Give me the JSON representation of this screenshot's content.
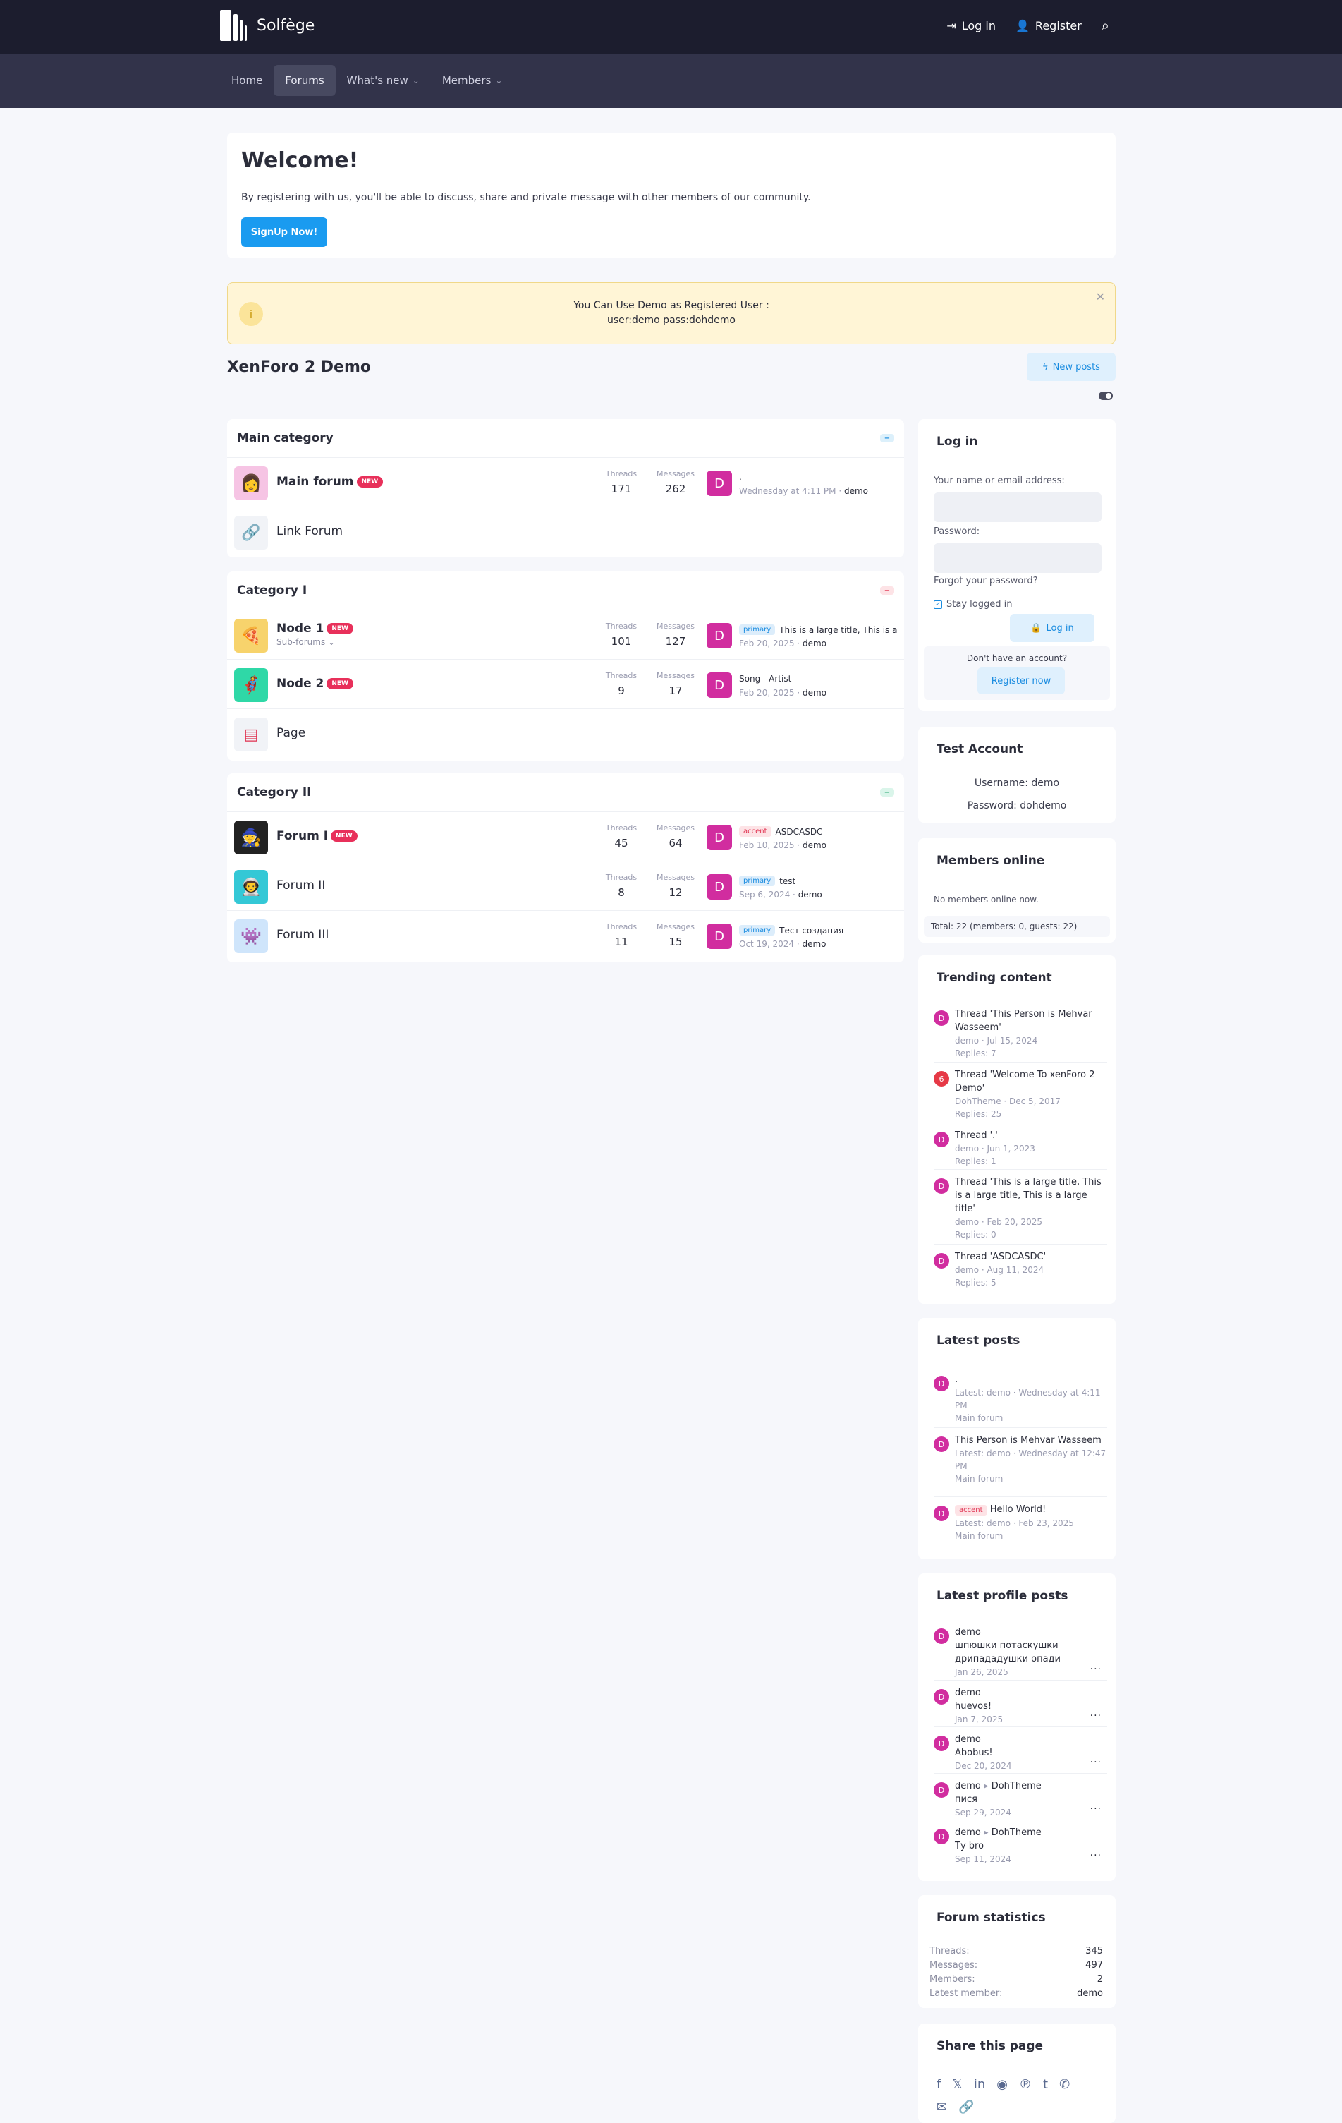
{
  "brand": {
    "name": "Solfège"
  },
  "topnav": {
    "login": "Log in",
    "register": "Register"
  },
  "tabs": {
    "home": "Home",
    "forums": "Forums",
    "whatsnew": "What's new",
    "members": "Members"
  },
  "welcome": {
    "title": "Welcome!",
    "text": "By registering with us, you'll be able to discuss, share and private message with other members of our community.",
    "button": "SignUp Now!"
  },
  "notice": {
    "line1": "You Can Use Demo as Registered User :",
    "line2": "user:demo pass:dohdemo"
  },
  "page": {
    "title": "XenForo 2 Demo",
    "new_posts": "New posts"
  },
  "labels": {
    "threads": "Threads",
    "messages": "Messages",
    "new": "NEW",
    "primary": "primary",
    "accent": "accent"
  },
  "categories": [
    {
      "title": "Main category",
      "nodes": [
        {
          "name": "Main forum",
          "threads": "171",
          "messages": "262",
          "lp_title": ".",
          "lp_date": "Wednesday at 4:11 PM",
          "lp_user": "demo"
        },
        {
          "name": "Link Forum"
        }
      ]
    },
    {
      "title": "Category I",
      "nodes": [
        {
          "name": "Node 1",
          "sub": "Sub-forums",
          "threads": "101",
          "messages": "127",
          "lp_title": "This is a large title, This is a large title",
          "lp_date": "Feb 20, 2025",
          "lp_user": "demo"
        },
        {
          "name": "Node 2",
          "threads": "9",
          "messages": "17",
          "lp_title": "Song - Artist",
          "lp_date": "Feb 20, 2025",
          "lp_user": "demo"
        },
        {
          "name": "Page"
        }
      ]
    },
    {
      "title": "Category II",
      "nodes": [
        {
          "name": "Forum I",
          "threads": "45",
          "messages": "64",
          "lp_title": "ASDCASDC",
          "lp_date": "Feb 10, 2025",
          "lp_user": "demo"
        },
        {
          "name": "Forum II",
          "threads": "8",
          "messages": "12",
          "lp_title": "test",
          "lp_date": "Sep 6, 2024",
          "lp_user": "demo"
        },
        {
          "name": "Forum III",
          "threads": "11",
          "messages": "15",
          "lp_title": "Тест создания",
          "lp_date": "Oct 19, 2024",
          "lp_user": "demo"
        }
      ]
    }
  ],
  "login": {
    "title": "Log in",
    "user_label": "Your name or email address:",
    "pass_label": "Password:",
    "forgot": "Forgot your password?",
    "stay": "Stay logged in",
    "button": "Log in",
    "no_account": "Don't have an account?",
    "register": "Register now"
  },
  "test_account": {
    "title": "Test Account",
    "username": "Username: demo",
    "password": "Password: dohdemo"
  },
  "members_online": {
    "title": "Members online",
    "none": "No members online now.",
    "total": "Total: 22 (members: 0, guests: 22)"
  },
  "trending": {
    "title": "Trending content",
    "items": [
      {
        "av": "D",
        "title": "Thread 'This Person is Mehvar Wasseem'",
        "meta": "demo · Jul 15, 2024",
        "replies": "Replies: 7"
      },
      {
        "av": "6",
        "title": "Thread 'Welcome To xenForo 2 Demo'",
        "meta": "DohTheme · Dec 5, 2017",
        "replies": "Replies: 25"
      },
      {
        "av": "D",
        "title": "Thread '.'",
        "meta": "demo · Jun 1, 2023",
        "replies": "Replies: 1"
      },
      {
        "av": "D",
        "title": "Thread 'This is a large title, This is a large title, This is a large title'",
        "meta": "demo · Feb 20, 2025",
        "replies": "Replies: 0"
      },
      {
        "av": "D",
        "title": "Thread 'ASDCASDC'",
        "meta": "demo · Aug 11, 2024",
        "replies": "Replies: 5"
      }
    ]
  },
  "latest_posts": {
    "title": "Latest posts",
    "items": [
      {
        "title": ".",
        "meta": "Latest: demo · Wednesday at 4:11 PM",
        "forum": "Main forum"
      },
      {
        "title": "This Person is Mehvar Wasseem",
        "meta": "Latest: demo · Wednesday at 12:47 PM",
        "forum": "Main forum"
      },
      {
        "title": "Hello World!",
        "meta": "Latest: demo · Feb 23, 2025",
        "forum": "Main forum"
      }
    ]
  },
  "profile_posts": {
    "title": "Latest profile posts",
    "items": [
      {
        "user": "demo",
        "text": "шпюшки потаскушки дрипададушки опади",
        "date": "Jan 26, 2025"
      },
      {
        "user": "demo",
        "text": "huevos!",
        "date": "Jan 7, 2025"
      },
      {
        "user": "demo",
        "text": "Abobus!",
        "date": "Dec 20, 2024"
      },
      {
        "user": "demo",
        "target": "DohTheme",
        "text": "пися",
        "date": "Sep 29, 2024"
      },
      {
        "user": "demo",
        "target": "DohTheme",
        "text": "Ту bro",
        "date": "Sep 11, 2024"
      }
    ]
  },
  "stats": {
    "title": "Forum statistics",
    "threads_k": "Threads:",
    "threads_v": "345",
    "messages_k": "Messages:",
    "messages_v": "497",
    "members_k": "Members:",
    "members_v": "2",
    "latest_k": "Latest member:",
    "latest_v": "demo"
  },
  "share": {
    "title": "Share this page"
  }
}
